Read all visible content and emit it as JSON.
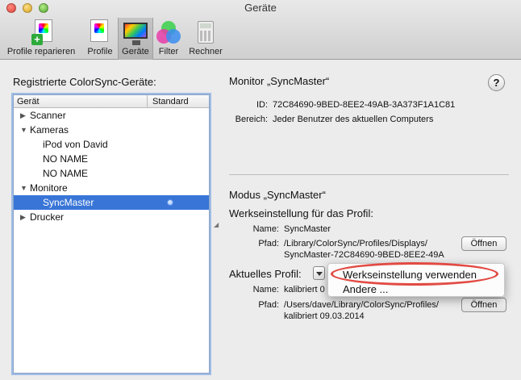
{
  "window": {
    "title": "Geräte"
  },
  "toolbar": {
    "items": [
      {
        "label": "Profile reparieren",
        "icon": "profile-repair-icon"
      },
      {
        "label": "Profile",
        "icon": "profile-icon"
      },
      {
        "label": "Geräte",
        "icon": "monitor-icon"
      },
      {
        "label": "Filter",
        "icon": "filter-icon"
      },
      {
        "label": "Rechner",
        "icon": "calculator-icon"
      }
    ],
    "selected": "Geräte"
  },
  "left": {
    "title": "Registrierte ColorSync-Geräte:",
    "columns": {
      "device": "Gerät",
      "default": "Standard"
    },
    "tree": [
      {
        "label": "Scanner",
        "level": 0,
        "expanded": false
      },
      {
        "label": "Kameras",
        "level": 0,
        "expanded": true
      },
      {
        "label": "iPod von David",
        "level": 1
      },
      {
        "label": "NO NAME",
        "level": 1
      },
      {
        "label": "NO NAME",
        "level": 1
      },
      {
        "label": "Monitore",
        "level": 0,
        "expanded": true
      },
      {
        "label": "SyncMaster",
        "level": 1,
        "selected": true,
        "default": true
      },
      {
        "label": "Drucker",
        "level": 0,
        "expanded": false
      }
    ]
  },
  "device": {
    "title": "Monitor „SyncMaster“",
    "id_label": "ID:",
    "id": "72C84690-9BED-8EE2-49AB-3A373F1A1C81",
    "scope_label": "Bereich:",
    "scope": "Jeder Benutzer des aktuellen Computers"
  },
  "mode": {
    "title": "Modus „SyncMaster“",
    "factory_heading": "Werkseinstellung für das Profil:",
    "name_label": "Name:",
    "factory_name": "SyncMaster",
    "path_label": "Pfad:",
    "factory_path_1": "/Library/ColorSync/Profiles/Displays/",
    "factory_path_2": "SyncMaster-72C84690-9BED-8EE2-49A",
    "open_label": "Öffnen",
    "current_label": "Aktuelles Profil:",
    "current_name": "kalibriert 0",
    "current_path_1": "/Users/dave/Library/ColorSync/Profiles/",
    "current_path_2": "kalibriert 09.03.2014"
  },
  "popup_menu": {
    "items": [
      "Werkseinstellung verwenden",
      "Andere ..."
    ],
    "highlighted": "Werkseinstellung verwenden"
  },
  "colors": {
    "selection": "#3875d7",
    "highlight_ring": "#e24a43"
  }
}
